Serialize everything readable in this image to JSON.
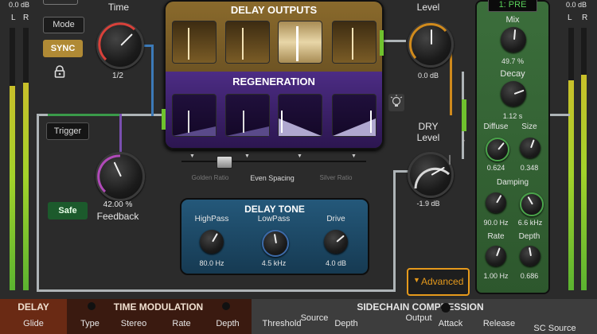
{
  "meters": {
    "left": {
      "db": "0.0 dB",
      "l": "L",
      "r": "R",
      "levels": [
        0.78,
        0.79
      ]
    },
    "right": {
      "db": "0.0 dB",
      "l": "L",
      "r": "R",
      "levels": [
        0.8,
        0.82
      ]
    }
  },
  "delay": {
    "time_label": "Time",
    "time_value": "1/2",
    "mode_label": "Mode",
    "sync_label": "SYNC",
    "trigger_label": "Trigger",
    "feedback_value": "42.00 %",
    "feedback_label": "Feedback",
    "safe_label": "Safe"
  },
  "center": {
    "delay_outputs_title": "DELAY OUTPUTS",
    "regeneration_title": "REGENERATION",
    "spacing": {
      "left": "Golden Ratio",
      "center": "Even Spacing",
      "right": "Silver Ratio"
    }
  },
  "delay_tone": {
    "title": "DELAY TONE",
    "knobs": [
      {
        "label": "HighPass",
        "value": "80.0 Hz"
      },
      {
        "label": "LowPass",
        "value": "4.5 kHz"
      },
      {
        "label": "Drive",
        "value": "4.0 dB"
      }
    ]
  },
  "wet": {
    "label": "Level",
    "value": "0.0 dB"
  },
  "dry": {
    "label_1": "DRY",
    "label_2": "Level",
    "value": "-1.9 dB"
  },
  "advanced_label": "Advanced",
  "reverb": {
    "preset": "1: PRE",
    "mix_label": "Mix",
    "mix_value": "49.7 %",
    "decay_label": "Decay",
    "decay_value": "1.12 s",
    "diffuse_label": "Diffuse",
    "diffuse_value": "0.624",
    "size_label": "Size",
    "size_value": "0.348",
    "damping_label": "Damping",
    "damping_low": "90.0 Hz",
    "damping_high": "6.6 kHz",
    "rate_label": "Rate",
    "rate_value": "1.00 Hz",
    "depth_label": "Depth",
    "depth_value": "0.686"
  },
  "bottom": {
    "delay_tab": "DELAY",
    "glide_label": "Glide",
    "time_mod_title": "TIME MODULATION",
    "time_mod_labels": [
      "Type",
      "Stereo",
      "Rate",
      "Depth"
    ],
    "sidechain_title": "SIDECHAIN COMPRESSION",
    "sidechain_labels": [
      "Threshold",
      "Source",
      "Depth",
      "Output",
      "Attack",
      "Release",
      "SC Source"
    ]
  },
  "colors": {
    "gold": "#caa45a",
    "purple": "#3d2370",
    "green_panel": "#2f5a2f",
    "accent_orange": "#e69a1c",
    "tone_blue": "#1f4a66"
  }
}
